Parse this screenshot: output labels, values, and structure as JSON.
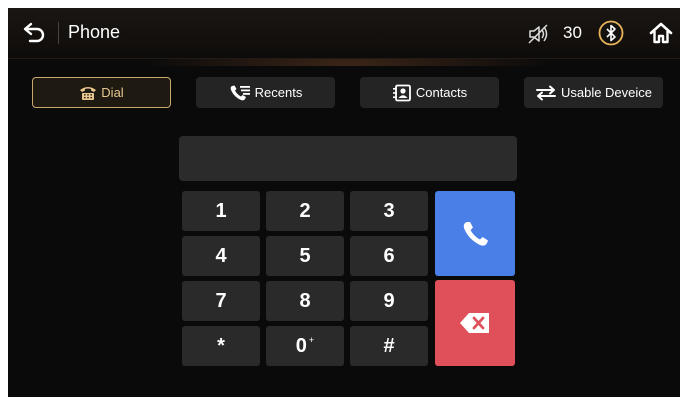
{
  "header": {
    "title": "Phone",
    "volume": "30",
    "icons": [
      "back-arrow-icon",
      "mute-icon",
      "bluetooth-icon",
      "home-icon"
    ]
  },
  "tabs": [
    {
      "label": "Dial",
      "icon": "rotary-phone-icon",
      "active": true
    },
    {
      "label": "Recents",
      "icon": "call-log-icon",
      "active": false
    },
    {
      "label": "Contacts",
      "icon": "contact-card-icon",
      "active": false
    },
    {
      "label": "Usable Deveice",
      "icon": "swap-arrows-icon",
      "active": false
    }
  ],
  "keypad": {
    "display_value": "",
    "keys": [
      "1",
      "2",
      "3",
      "4",
      "5",
      "6",
      "7",
      "8",
      "9",
      "*",
      "0",
      "#"
    ],
    "zero_sub": "+"
  },
  "actions": {
    "call_icon": "phone-handset-icon",
    "delete_icon": "backspace-icon"
  },
  "colors": {
    "accent": "#c9a86e",
    "call": "#4a7fe8",
    "delete": "#e0505a",
    "background": "#0a0a0a"
  }
}
